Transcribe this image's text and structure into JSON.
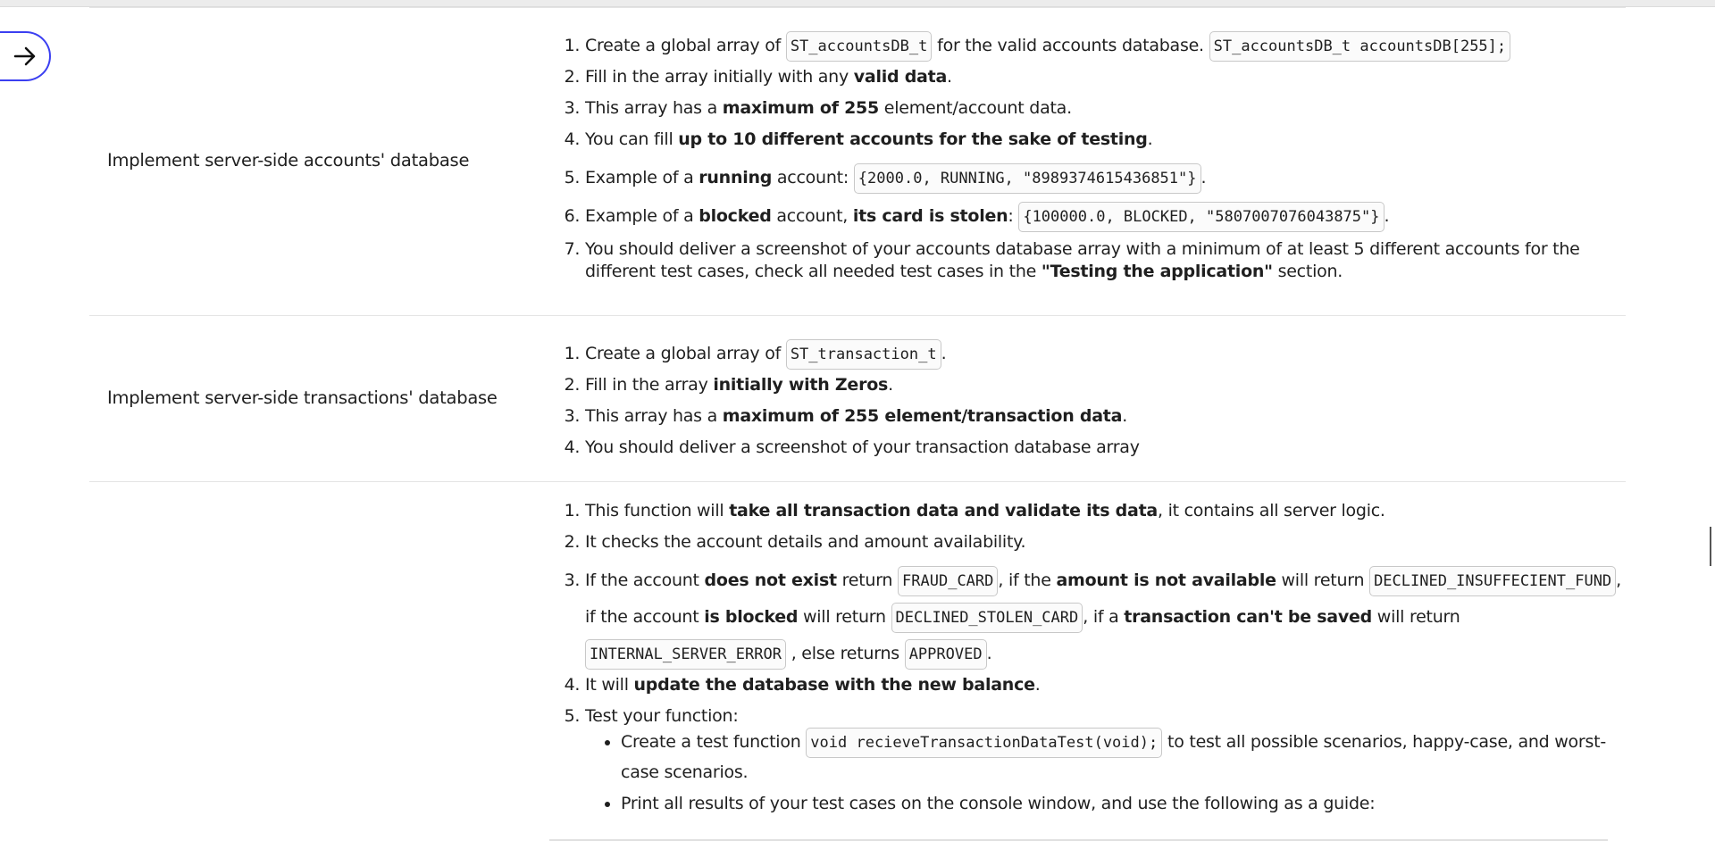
{
  "side_button": {
    "icon": "arrow-right-icon",
    "accent": "#3b3ff1"
  },
  "rows": [
    {
      "title": "Implement server-side accounts' database",
      "items": [
        {
          "t1": "Create a global array of ",
          "c1": "ST_accountsDB_t",
          "t2": " for the valid accounts database. ",
          "c2": "ST_accountsDB_t accountsDB[255];"
        },
        {
          "t1": "Fill in the array initially with any ",
          "b1": "valid data",
          "t2": "."
        },
        {
          "t1": "This array has a ",
          "b1": "maximum of 255",
          "t2": " element/account data."
        },
        {
          "t1": "You can fill ",
          "b1": "up to 10 different accounts for the sake of testing",
          "t2": "."
        },
        {
          "t1": "Example of a ",
          "b1": "running",
          "t2": " account: ",
          "c1": "{2000.0, RUNNING, \"8989374615436851\"}",
          "t3": "."
        },
        {
          "t1": "Example of a ",
          "b1": "blocked",
          "t2": " account, ",
          "b2": "its card is stolen",
          "t3": ": ",
          "c1": "{100000.0, BLOCKED, \"5807007076043875\"}",
          "t4": "."
        },
        {
          "t1": "You should deliver a screenshot of your accounts database array with a minimum of at least 5 different accounts for the different test cases, check all needed test cases in the ",
          "b1": "\"Testing the application\"",
          "t2": " section."
        }
      ]
    },
    {
      "title": "Implement server-side transactions' database",
      "items": [
        {
          "t1": "Create a global array of ",
          "c1": "ST_transaction_t",
          "t2": "."
        },
        {
          "t1": "Fill in the array ",
          "b1": "initially with Zeros",
          "t2": "."
        },
        {
          "t1": "This array has a ",
          "b1": "maximum of 255 element/transaction data",
          "t2": "."
        },
        {
          "t1": "You should deliver a screenshot of your transaction database array"
        }
      ]
    },
    {
      "title": "",
      "items": [
        {
          "t1": "This function will ",
          "b1": "take all transaction data and validate its data",
          "t2": ", it contains all server logic."
        },
        {
          "t1": "It checks the account details and amount availability."
        },
        {
          "t1": "If the account ",
          "b1": "does not exist",
          "t2": " return ",
          "c1": "FRAUD_CARD",
          "t3": ", if the ",
          "b2": "amount is not available",
          "t4": " will return ",
          "c2": "DECLINED_INSUFFECIENT_FUND",
          "t5": ", if the account ",
          "b3": "is blocked",
          "t6": " will return ",
          "c3": "DECLINED_STOLEN_CARD",
          "t7": ", if a ",
          "b4": "transaction can't be saved",
          "t8": " will return ",
          "c4": "INTERNAL_SERVER_ERROR",
          "t9": " , else returns ",
          "c5": "APPROVED",
          "t10": "."
        },
        {
          "t1": "It will ",
          "b1": "update the database with the new balance",
          "t2": "."
        },
        {
          "t1": "Test your function:"
        }
      ],
      "sub_items": [
        {
          "t1": "Create a test function ",
          "c1": "void recieveTransactionDataTest(void);",
          "t2": " to test all possible scenarios, happy-case, and worst-case scenarios."
        },
        {
          "t1": "Print all results of your test cases on the console window, and use the following as a guide:"
        }
      ]
    }
  ]
}
